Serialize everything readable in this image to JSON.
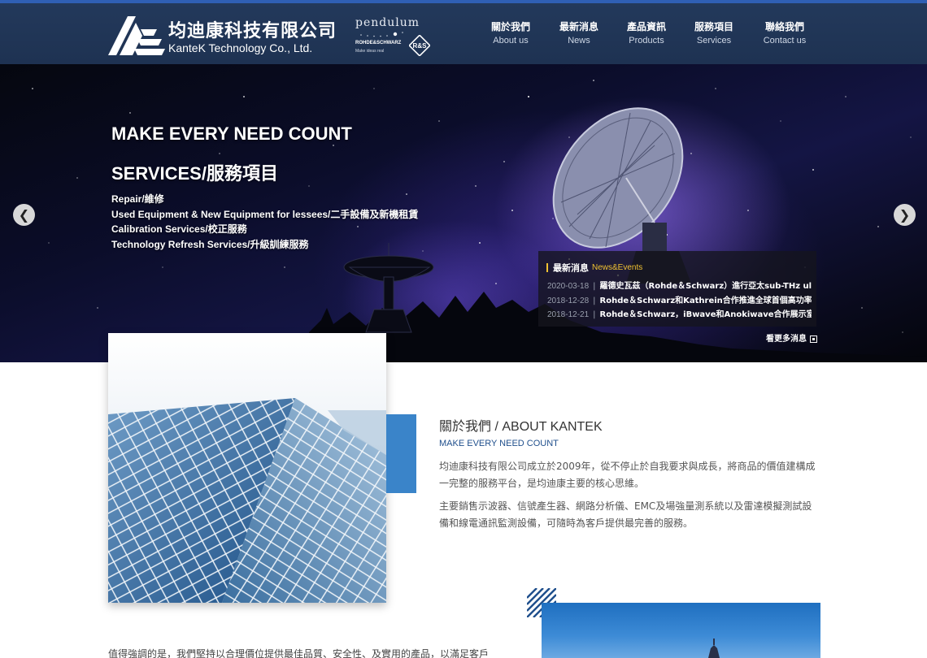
{
  "brand": {
    "name_zh": "均迪康科技有限公司",
    "name_en": "KanteK Technology Co., Ltd.",
    "partner_name": "pendulum",
    "partner_brand": "ROHDE&SCHWARZ",
    "partner_tagline": "Make ideas real",
    "partner_mark": "R&S"
  },
  "nav": {
    "items": [
      {
        "zh": "關於我們",
        "en": "About us"
      },
      {
        "zh": "最新消息",
        "en": "News"
      },
      {
        "zh": "產品資訊",
        "en": "Products"
      },
      {
        "zh": "服務項目",
        "en": "Services"
      },
      {
        "zh": "聯絡我們",
        "en": "Contact us"
      }
    ]
  },
  "hero": {
    "title1": "MAKE EVERY NEED COUNT",
    "title2": "SERVICES/服務項目",
    "lines": [
      "Repair/維修",
      "Used Equipment & New Equipment for lessees/二手設備及新機租賃",
      "Calibration Services/校正服務",
      "Technology Refresh Services/升級訓練服務"
    ],
    "prev_icon": "chevron-left-icon",
    "next_icon": "chevron-right-icon",
    "prev_glyph": "❮",
    "next_glyph": "❯"
  },
  "news": {
    "title_zh": "最新消息",
    "title_en": "News&Events",
    "separator": "|",
    "items": [
      {
        "date": "2020-03-18",
        "text": "羅德史瓦茲（Rohde＆Schwarz）進行亞太sub-THz ultr..."
      },
      {
        "date": "2018-12-28",
        "text": "Rohde＆Schwarz和Kathrein合作推進全球首個高功率..."
      },
      {
        "date": "2018-12-21",
        "text": "Rohde＆Schwarz，iBwave和Anokiwave合作展示室內..."
      }
    ],
    "more_label": "看更多消息"
  },
  "about": {
    "title_zh": "關於我們",
    "title_en": " / ABOUT KANTEK",
    "subtitle": "MAKE EVERY NEED COUNT",
    "p1": "均迪康科技有限公司成立於2009年，從不停止於自我要求與成長，將商品的價值建構成一完整的服務平台，是均迪康主要的核心思維。",
    "p2": "主要銷售示波器、信號產生器、網路分析儀、EMC及場強量測系統以及雷達模擬測試設備和線電通訊監測設備，可隨時為客戶提供最完善的服務。",
    "bottom": "值得強調的是，我們堅持以合理價位提供最佳品質、安全性、及實用的產品，以滿足客戶"
  },
  "colors": {
    "header_bg": "#23395b",
    "header_top_border": "#2f5fb4",
    "accent_blue": "#3a84c9",
    "news_highlight": "#f1c232",
    "subtitle_blue": "#1f4f8c"
  }
}
